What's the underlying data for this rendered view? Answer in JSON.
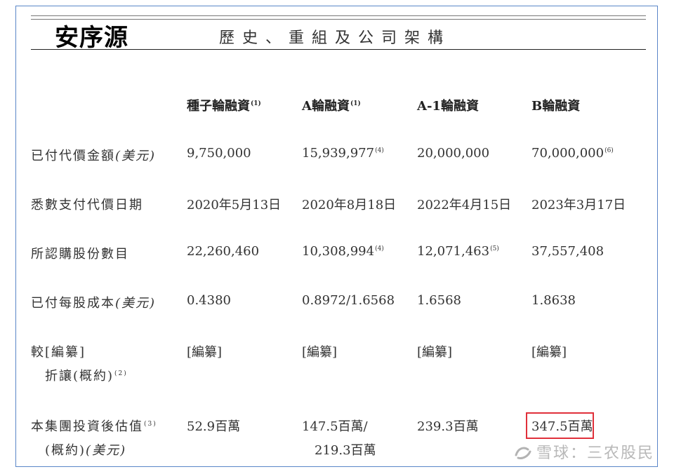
{
  "header": {
    "company": "安序源",
    "section_title": "歷史、重組及公司架構"
  },
  "columns": [
    {
      "label": "種子輪融資",
      "note": "(1)"
    },
    {
      "label": "A輪融資",
      "note": "(1)"
    },
    {
      "label": "A-1輪融資",
      "note": ""
    },
    {
      "label": "B輪融資",
      "note": ""
    }
  ],
  "rows": {
    "paid_amount": {
      "label": "已付代價金額",
      "unit": "(美元)",
      "values": [
        "9,750,000",
        "15,939,977",
        "20,000,000",
        "70,000,000"
      ],
      "notes": [
        "",
        "(4)",
        "",
        "(6)"
      ]
    },
    "payment_date": {
      "label": "悉數支付代價日期",
      "values": [
        "2020年5月13日",
        "2020年8月18日",
        "2022年4月15日",
        "2023年3月17日"
      ]
    },
    "shares": {
      "label": "所認購股份數目",
      "values": [
        "22,260,460",
        "10,308,994",
        "12,071,463",
        "37,557,408"
      ],
      "notes": [
        "",
        "(4)",
        "(5)",
        ""
      ]
    },
    "cost_per_share": {
      "label": "已付每股成本",
      "unit": "(美元)",
      "values": [
        "0.4380",
        "0.8972/1.6568",
        "1.6568",
        "1.8638"
      ]
    },
    "discount": {
      "label_line1": "較[編纂]",
      "label_line2": "折讓(概約)",
      "note": "(2)",
      "values": [
        "[編纂]",
        "[編纂]",
        "[編纂]",
        "[編纂]"
      ]
    },
    "valuation": {
      "label_line1": "本集團投資後估值",
      "note": "(3)",
      "label_line2": "(概約)",
      "unit": "(美元)",
      "values": [
        "52.9百萬",
        "147.5百萬/",
        "239.3百萬",
        "347.5百萬"
      ],
      "second_line": "219.3百萬"
    }
  },
  "watermark": {
    "text": "雪球：三农股民",
    "icon": "snowball-logo-icon"
  },
  "colors": {
    "highlight_border": "#e0303a",
    "frame_border": "#5a86c8"
  }
}
